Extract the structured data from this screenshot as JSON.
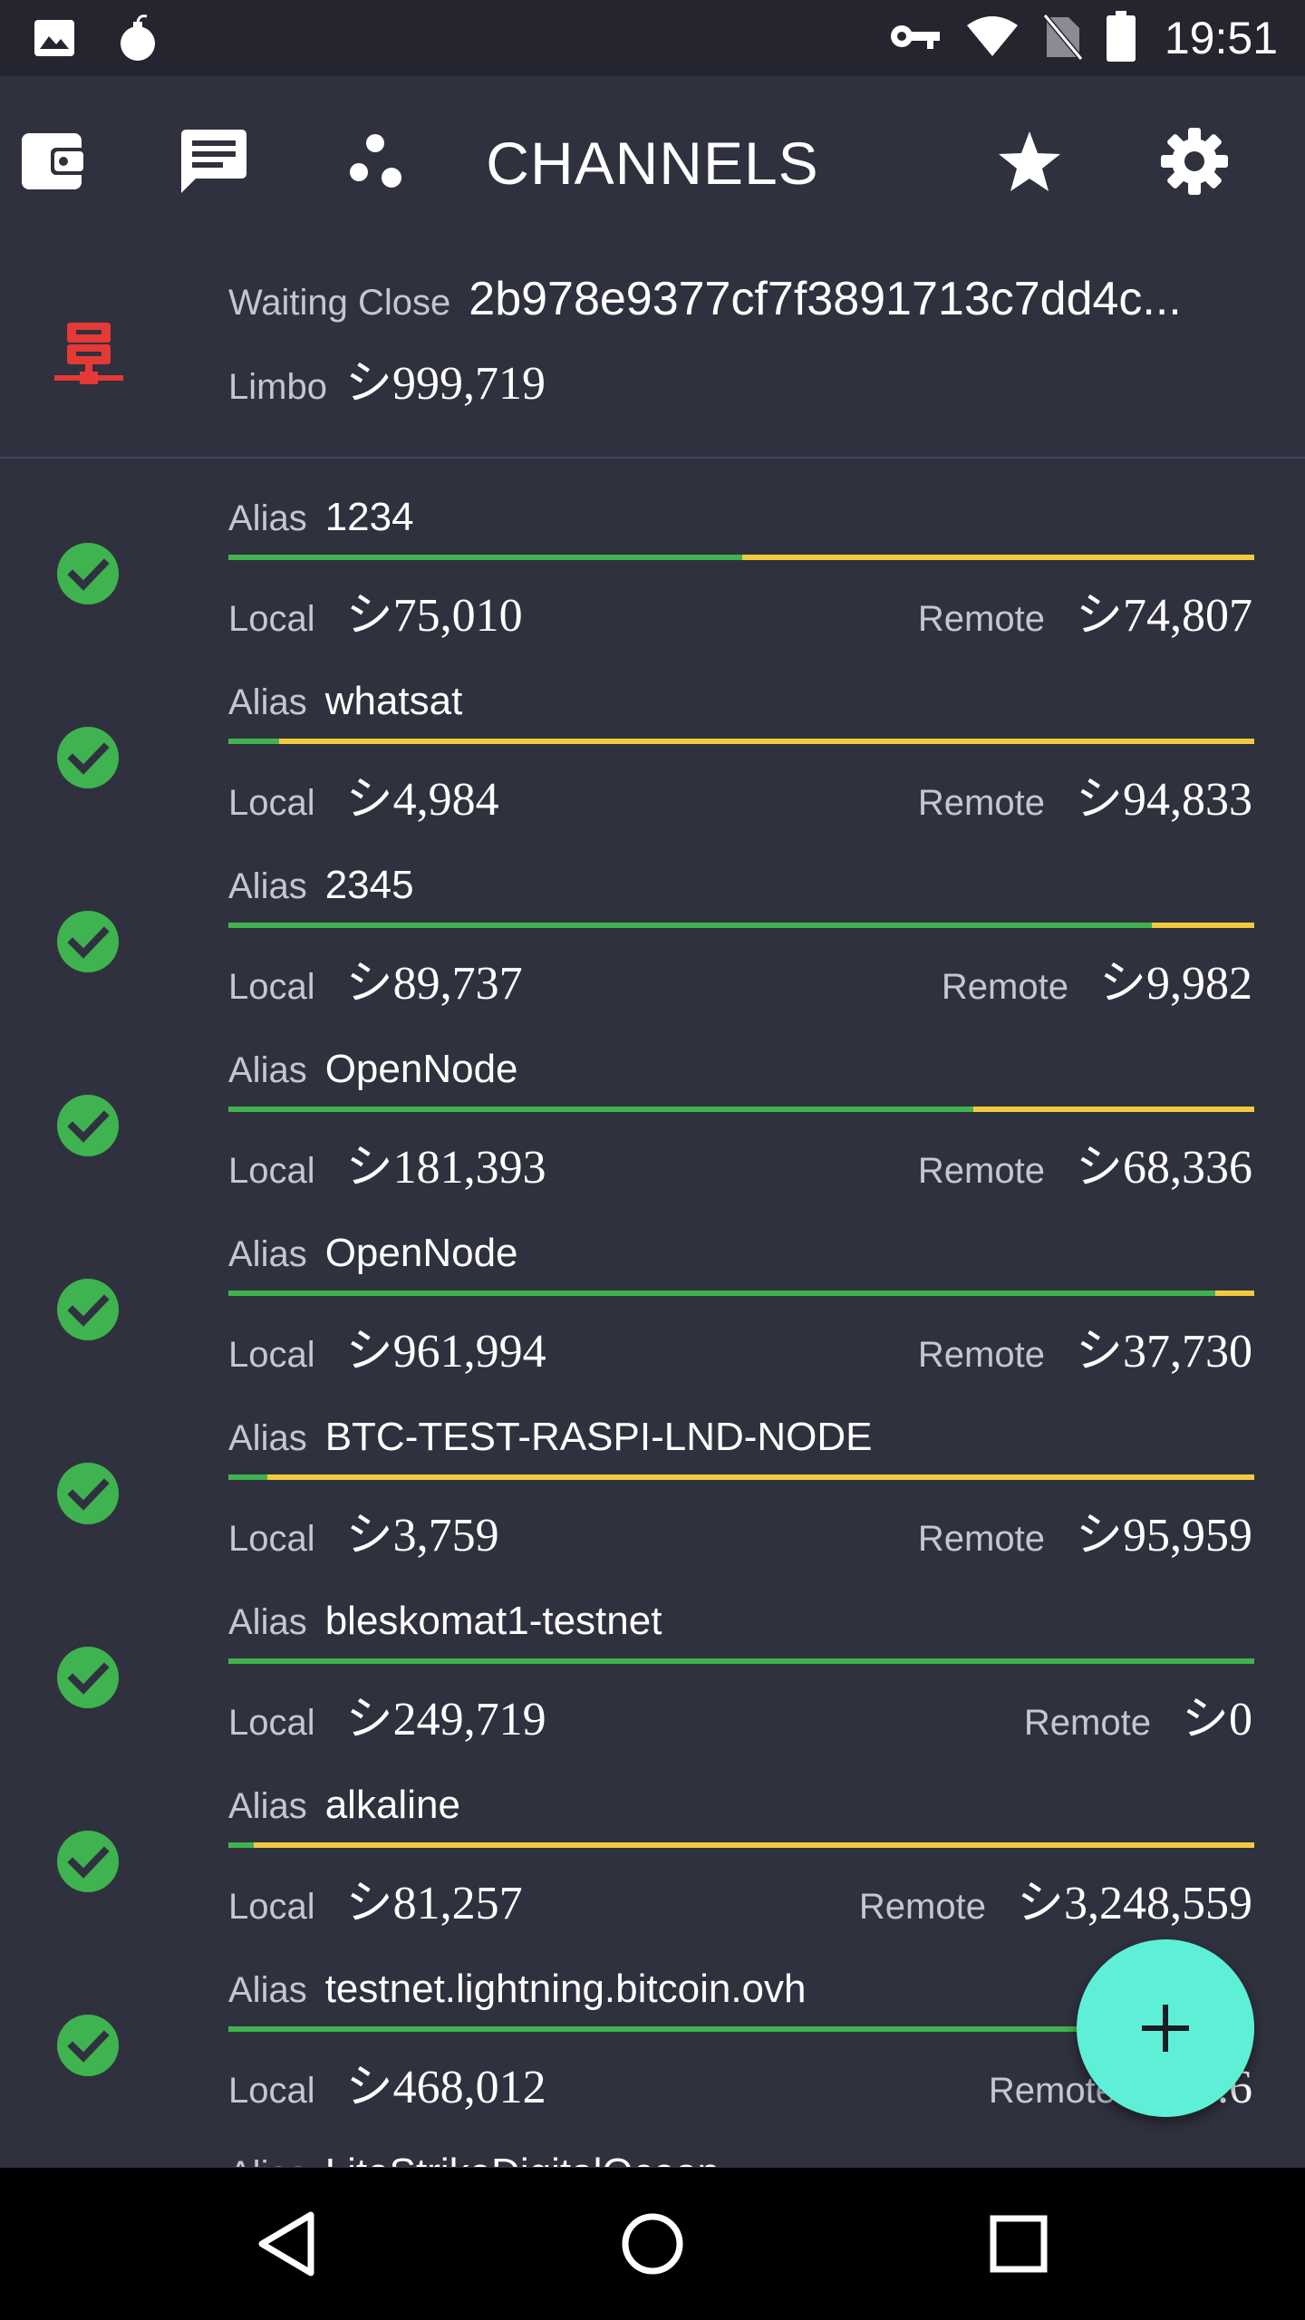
{
  "status_bar": {
    "time": "19:51",
    "left_icons": [
      "image-icon",
      "bomb-icon"
    ],
    "right_icons": [
      "vpn-key-icon",
      "wifi-icon",
      "no-sim-icon",
      "battery-icon"
    ]
  },
  "toolbar": {
    "title": "CHANNELS",
    "icons": [
      "wallet-icon",
      "messages-icon",
      "network-icon",
      "star-icon",
      "settings-icon"
    ]
  },
  "pending": {
    "status_label": "Waiting Close",
    "channel_point": "2b978e9377cf7f3891713c7dd4c...",
    "limbo_label": "Limbo",
    "limbo_value": "シ999,719",
    "icon": "server-closing-icon",
    "icon_color": "#e53935"
  },
  "labels": {
    "alias": "Alias",
    "local": "Local",
    "remote": "Remote"
  },
  "colors": {
    "local_bar": "#3fb34f",
    "remote_bar": "#f2cb3c",
    "check": "#3fb34f",
    "fab": "#5ef0d6",
    "background": "#30313f"
  },
  "channels": [
    {
      "alias": "1234",
      "local": "シ75,010",
      "remote": "シ74,807",
      "local_fraction": 0.5007
    },
    {
      "alias": "whatsat",
      "local": "シ4,984",
      "remote": "シ94,833",
      "local_fraction": 0.0499
    },
    {
      "alias": "2345",
      "local": "シ89,737",
      "remote": "シ9,982",
      "local_fraction": 0.8999
    },
    {
      "alias": "OpenNode",
      "local": "シ181,393",
      "remote": "シ68,336",
      "local_fraction": 0.7264
    },
    {
      "alias": "OpenNode",
      "local": "シ961,994",
      "remote": "シ37,730",
      "local_fraction": 0.9623
    },
    {
      "alias": "BTC-TEST-RASPI-LND-NODE",
      "local": "シ3,759",
      "remote": "シ95,959",
      "local_fraction": 0.0377
    },
    {
      "alias": "bleskomat1-testnet",
      "local": "シ249,719",
      "remote": "シ0",
      "local_fraction": 1.0
    },
    {
      "alias": "alkaline",
      "local": "シ81,257",
      "remote": "シ3,248,559",
      "local_fraction": 0.0244
    },
    {
      "alias": "testnet.lightning.bitcoin.ovh",
      "local": "シ468,012",
      "remote": "シ...6",
      "local_fraction": 0.97
    },
    {
      "alias": "LiteStrikeDigitalOcean",
      "local": "",
      "remote": "",
      "local_fraction": 0.5
    }
  ],
  "fab": {
    "icon": "plus-icon"
  },
  "nav_bar": {
    "icons": [
      "back-icon",
      "home-icon",
      "recents-icon"
    ]
  }
}
